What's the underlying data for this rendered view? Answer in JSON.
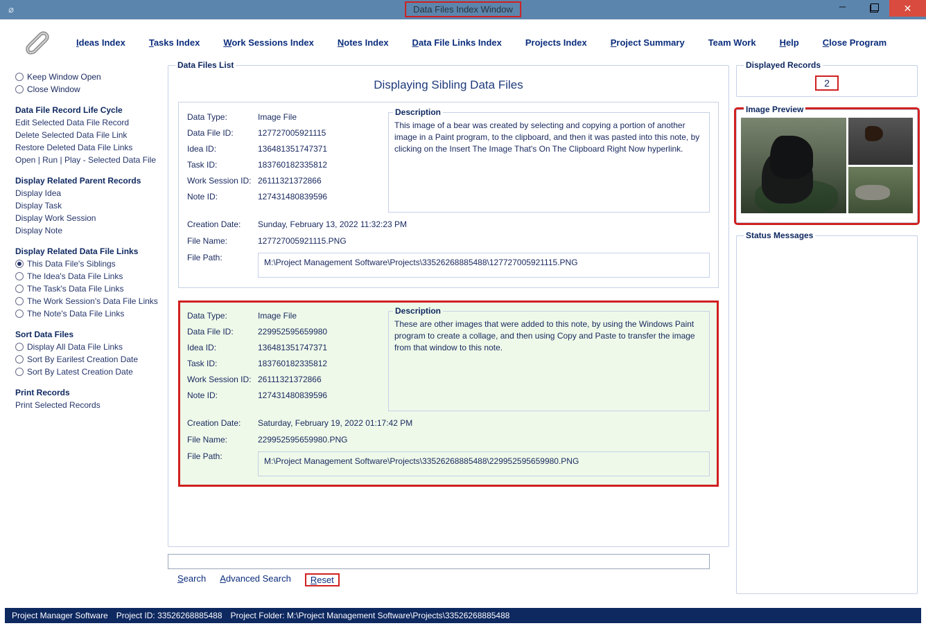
{
  "window": {
    "title": "Data Files Index Window"
  },
  "menu": {
    "items": [
      "Ideas Index",
      "Tasks Index",
      "Work Sessions Index",
      "Notes Index",
      "Data File Links Index",
      "Projects Index",
      "Project Summary",
      "Team Work",
      "Help",
      "Close Program"
    ]
  },
  "left": {
    "keep_open": "Keep Window Open",
    "close_window": "Close Window",
    "lifecycle_head": "Data File Record Life Cycle",
    "lifecycle": [
      "Edit Selected Data File Record",
      "Delete Selected Data File Link",
      "Restore Deleted Data File Links",
      "Open | Run | Play - Selected Data File"
    ],
    "parent_head": "Display Related Parent Records",
    "parent": [
      "Display Idea",
      "Display Task",
      "Display Work Session",
      "Display Note"
    ],
    "links_head": "Display Related Data File Links",
    "links": [
      "This Data File's Siblings",
      "The Idea's Data File Links",
      "The Task's Data File Links",
      "The Work Session's Data File Links",
      "The Note's Data File Links"
    ],
    "sort_head": "Sort Data Files",
    "sort": [
      "Display All Data File Links",
      "Sort By Earilest Creation Date",
      "Sort By Latest Creation Date"
    ],
    "print_head": "Print Records",
    "print": [
      "Print Selected Records"
    ]
  },
  "center": {
    "group_title": "Data Files List",
    "header": "Displaying Sibling Data Files",
    "labels": {
      "data_type": "Data Type:",
      "data_file_id": "Data File ID:",
      "idea_id": "Idea ID:",
      "task_id": "Task ID:",
      "work_session_id": "Work Session ID:",
      "note_id": "Note ID:",
      "creation_date": "Creation Date:",
      "file_name": "File Name:",
      "file_path": "File Path:",
      "description": "Description"
    },
    "records": [
      {
        "data_type": "Image File",
        "data_file_id": "127727005921115",
        "idea_id": "136481351747371",
        "task_id": "183760182335812",
        "work_session_id": "26111321372866",
        "note_id": "127431480839596",
        "creation_date": "Sunday, February 13, 2022   11:32:23 PM",
        "file_name": "127727005921115.PNG",
        "file_path": "M:\\Project Management Software\\Projects\\33526268885488\\127727005921115.PNG",
        "description": "This image of a bear was created by selecting and copying a portion of another image in a Paint program, to the clipboard, and then it was pasted into this note, by clicking on the Insert The Image That's On The Clipboard Right Now hyperlink."
      },
      {
        "data_type": "Image File",
        "data_file_id": "229952595659980",
        "idea_id": "136481351747371",
        "task_id": "183760182335812",
        "work_session_id": "26111321372866",
        "note_id": "127431480839596",
        "creation_date": "Saturday, February 19, 2022   01:17:42 PM",
        "file_name": "229952595659980.PNG",
        "file_path": "M:\\Project Management Software\\Projects\\33526268885488\\229952595659980.PNG",
        "description": "These are other images that were added to this note, by using the Windows Paint program to create a collage, and then using Copy and Paste to transfer the image from that window to this note."
      }
    ],
    "search": "Search",
    "adv_search": "Advanced Search",
    "reset": "Reset"
  },
  "right": {
    "displayed_records_label": "Displayed Records",
    "displayed_records_value": "2",
    "image_preview_label": "Image Preview",
    "status_label": "Status Messages"
  },
  "footer": {
    "app": "Project Manager Software",
    "project_id_label": "Project ID:",
    "project_id": "33526268885488",
    "project_folder_label": "Project Folder:",
    "project_folder": "M:\\Project Management Software\\Projects\\33526268885488"
  }
}
